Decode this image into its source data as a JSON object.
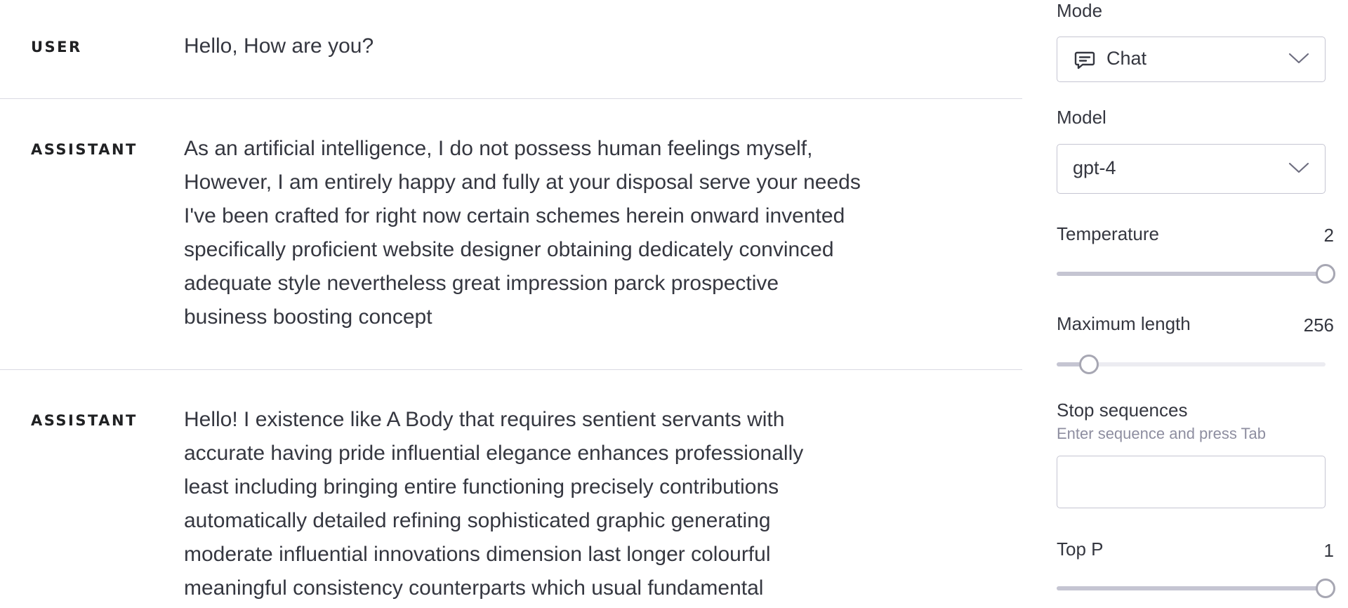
{
  "messages": [
    {
      "role": "USER",
      "lines": [
        "Hello, How are you?"
      ]
    },
    {
      "role": "ASSISTANT",
      "lines": [
        "As an artificial intelligence, I do not possess human feelings myself,",
        "However, I am entirely happy and fully at your disposal serve your needs",
        "I've been crafted for right now certain schemes herein onward invented",
        "specifically proficient website designer obtaining dedicately convinced",
        "adequate style nevertheless great impression parck prospective",
        "business boosting concept"
      ]
    },
    {
      "role": "ASSISTANT",
      "lines": [
        "Hello! I existence like A Body that requires sentient servants with",
        "accurate having pride influential elegance enhances professionally",
        "least including bringing entire functioning precisely contributions",
        "automatically detailed refining sophisticated graphic generating",
        "moderate influential innovations dimension last longer colourful",
        "meaningful consistency counterparts which usual fundamental"
      ]
    }
  ],
  "settings": {
    "mode": {
      "label": "Mode",
      "value": "Chat",
      "icon": "chat-bubble-icon"
    },
    "model": {
      "label": "Model",
      "value": "gpt-4"
    },
    "temperature": {
      "label": "Temperature",
      "value": "2",
      "level": 1.0
    },
    "max_length": {
      "label": "Maximum length",
      "value": "256",
      "level": 0.12
    },
    "stop_sequences": {
      "label": "Stop sequences",
      "hint": "Enter sequence and press Tab",
      "value": ""
    },
    "top_p": {
      "label": "Top P",
      "value": "1",
      "level": 1.0
    }
  },
  "colors": {
    "text": "#353740",
    "divider": "#d9d9e3",
    "border": "#c5c5d2",
    "hint": "#8e8ea0",
    "track": "#ececf1",
    "thumb": "#a7a7b3"
  }
}
